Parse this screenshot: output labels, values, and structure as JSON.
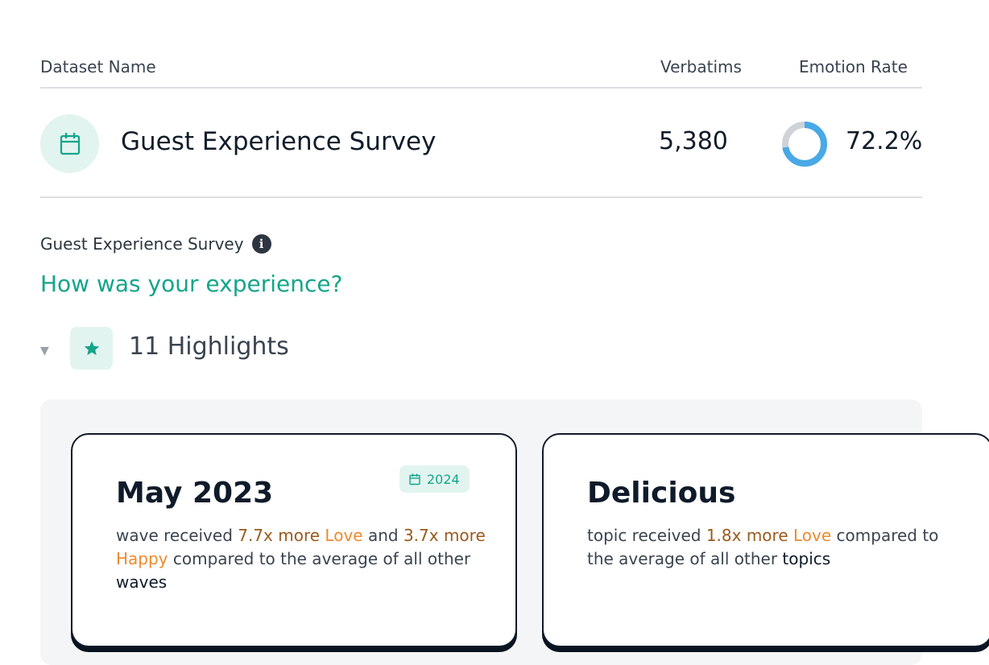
{
  "table": {
    "headers": {
      "name": "Dataset Name",
      "verbatims": "Verbatims",
      "rate": "Emotion Rate"
    },
    "row": {
      "name": "Guest Experience Survey",
      "verbatims": "5,380",
      "rate_label": "72.2%",
      "rate_value": 0.722
    }
  },
  "survey": {
    "title": "Guest Experience Survey",
    "question": "How was your experience?",
    "highlights_label": "11 Highlights"
  },
  "cards": [
    {
      "title": "May 2023",
      "badge": "2024",
      "body": {
        "p1": "wave received ",
        "m1": "7.7x more",
        "e1": "Love",
        "p2": " and ",
        "m2": "3.7x more",
        "e2": "Happy",
        "p3": " compared to the average of all other ",
        "s1": "waves"
      }
    },
    {
      "title": "Delicious",
      "body": {
        "p1": "topic received ",
        "m1": "1.8x more",
        "e1": "Love",
        "p2": " compared to the average of all other ",
        "s1": "topics"
      }
    }
  ],
  "colors": {
    "accent": "#14a58a",
    "donut_fill": "#49a9e6",
    "donut_track": "#cfd3d8"
  },
  "icons": {
    "dataset": "calendar-icon",
    "info": "info-icon",
    "highlight": "star-icon",
    "badge": "calendar-icon",
    "toggle": "caret-down-icon"
  }
}
